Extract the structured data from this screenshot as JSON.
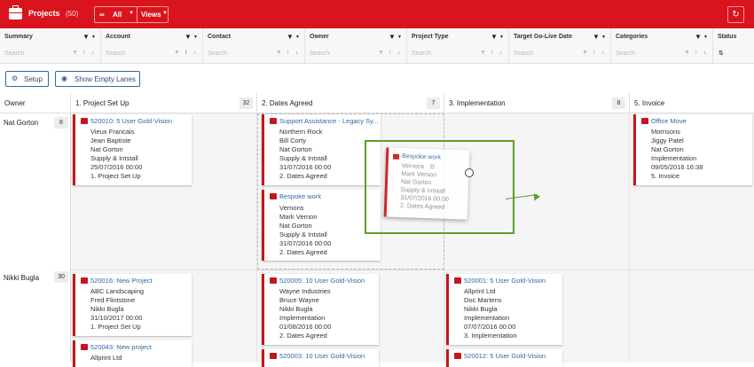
{
  "header": {
    "title": "Projects",
    "count": "(50)",
    "filter_label": "All",
    "views_label": "Views",
    "refresh_icon": "refresh-icon"
  },
  "filters": {
    "search_placeholder": "Search",
    "columns": [
      "Summary",
      "Account",
      "Contact",
      "Owner",
      "Project Type",
      "Target Go-Live Date",
      "Categories",
      "Status"
    ]
  },
  "toolbar": {
    "setup_label": "Setup",
    "empty_lanes_label": "Show Empty Lanes"
  },
  "lanes": {
    "owner_header": "Owner",
    "headers": [
      {
        "title": "1. Project Set Up",
        "count": "32"
      },
      {
        "title": "2. Dates Agreed",
        "count": "7"
      },
      {
        "title": "3. Implementation",
        "count": "8"
      },
      {
        "title": "5. Invoice",
        "count": ""
      }
    ]
  },
  "owners": [
    {
      "name": "Nat Gorton",
      "count": "8"
    },
    {
      "name": "Nikki Bugla",
      "count": "30"
    }
  ],
  "cards": {
    "c1": {
      "title": "520010: 5 User Gold-Vision",
      "lines": [
        "Vieux Francais",
        "Jean Baptiste",
        "Nat Gorton",
        "Supply & Intstall",
        "25/07/2016 00:00",
        "1. Project Set Up"
      ]
    },
    "c2": {
      "title": "Support Assistance - Legacy Sy...",
      "lines": [
        "Northern Rock",
        "Bill Corty",
        "Nat Gorton",
        "Supply & Intstall",
        "31/07/2016 00:00",
        "2. Dates Agreed"
      ]
    },
    "c3": {
      "title": "Bespoke work",
      "lines": [
        "Vernons",
        "Mark Vernon",
        "Nat Gorton",
        "Supply & Intstall",
        "31/07/2016 00:00",
        "2. Dates Agreed"
      ]
    },
    "c4": {
      "title": "Office Move",
      "lines": [
        "Morrisons",
        "Jiggy Patel",
        "Nat Gorton",
        "Implementation",
        "09/05/2016 16:38",
        "5. Invoice"
      ]
    },
    "c5": {
      "title": "520016: New Project",
      "lines": [
        "ABC Landscaping",
        "Fred Flintstone",
        "Nikki Bugla",
        "31/10/2017 00:00",
        "1. Project Set Up"
      ]
    },
    "c6": {
      "title": "520005: 10 User Gold-Vision",
      "lines": [
        "Wayne Industries",
        "Bruce Wayne",
        "Nikki Bugla",
        "Implementation",
        "01/08/2016 00:00",
        "2. Dates Agreed"
      ]
    },
    "c7": {
      "title": "520001: 5 User Gold-Vision",
      "lines": [
        "Allprint Ltd",
        "Doc Martens",
        "Nikki Bugla",
        "Implementation",
        "07/07/2016 00:00",
        "3. Implementation"
      ]
    },
    "c8": {
      "title": "520043: New project",
      "lines": [
        "Allprint Ltd"
      ]
    },
    "c9": {
      "title": "520003: 10 User Gold-Vision",
      "lines": []
    },
    "c10": {
      "title": "520012: 5 User Gold-Vision",
      "lines": []
    }
  },
  "ghost": {
    "title": "Bespoke work",
    "lines": [
      "Vernons",
      "Mark Vernon",
      "Nat Gorton",
      "Supply & Intstall",
      "31/07/2016 00:00",
      "2. Dates Agreed"
    ]
  },
  "colors": {
    "brand_red": "#d9141c",
    "card_accent": "#c4161c",
    "link_blue": "#2c6ba6",
    "highlight_green": "#5aa02c"
  }
}
